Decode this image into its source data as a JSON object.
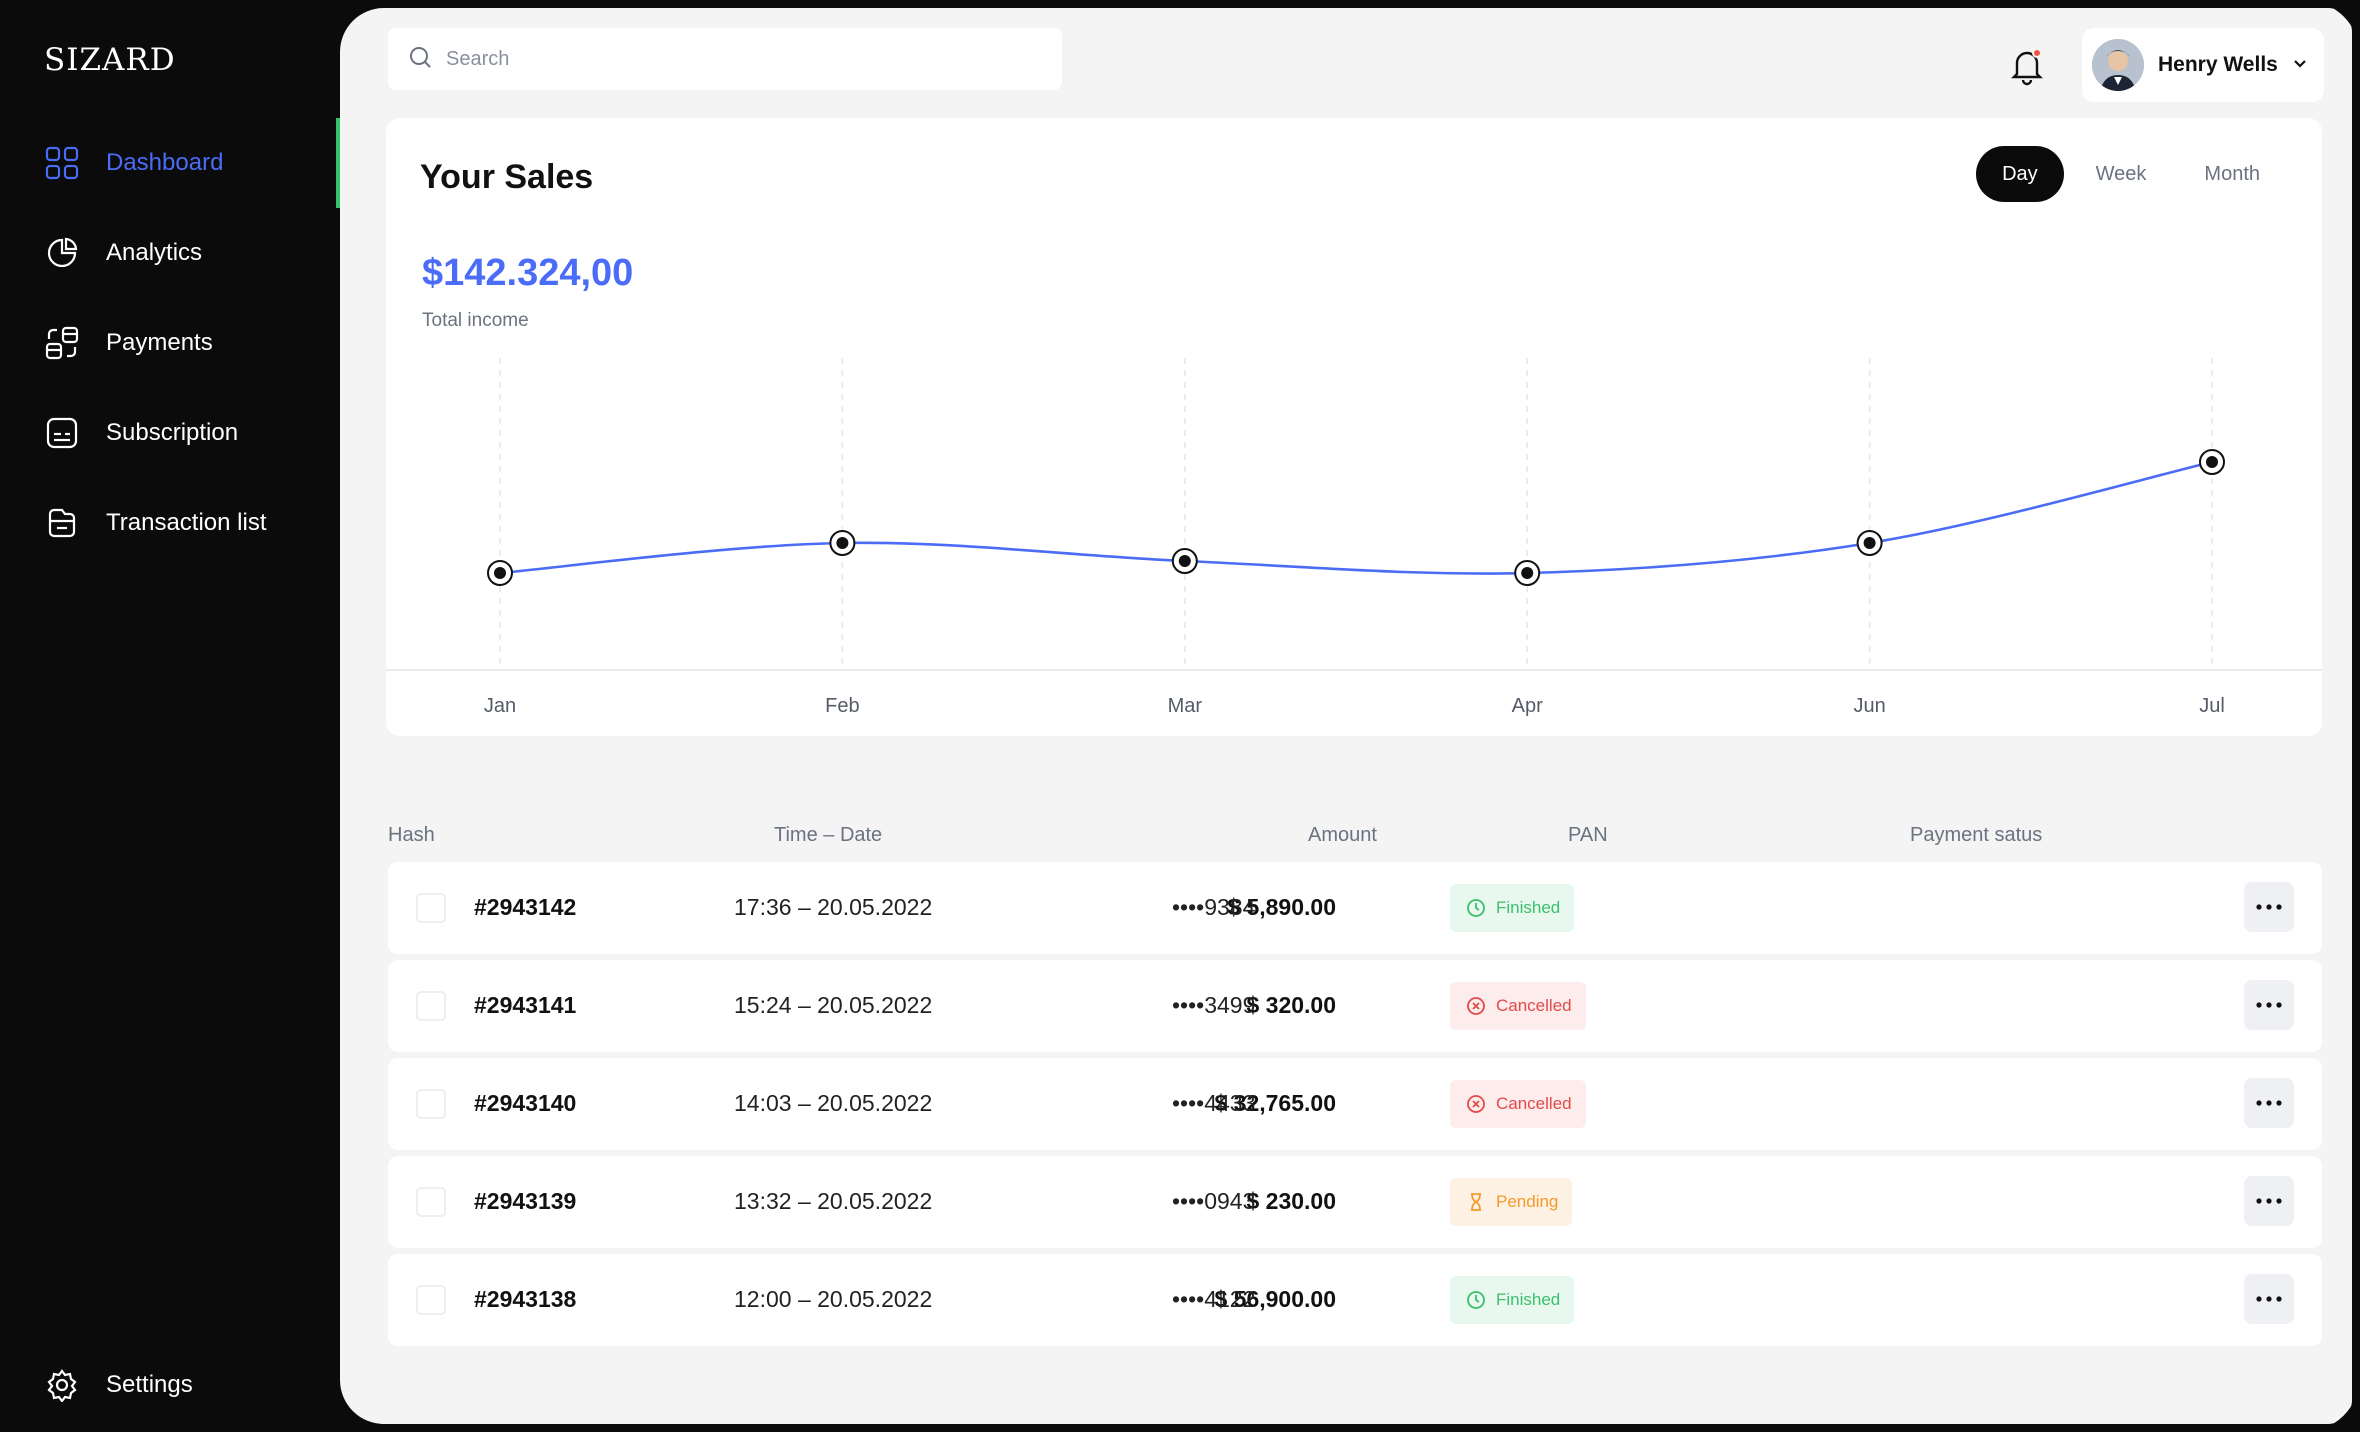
{
  "app": {
    "logo": "SIZARD"
  },
  "sidebar": {
    "items": [
      {
        "label": "Dashboard",
        "icon": "grid-icon",
        "active": true
      },
      {
        "label": "Analytics",
        "icon": "pie-chart-icon"
      },
      {
        "label": "Payments",
        "icon": "payments-icon"
      },
      {
        "label": "Subscription",
        "icon": "subscription-icon"
      },
      {
        "label": "Transaction list",
        "icon": "folder-icon"
      }
    ],
    "settings_label": "Settings"
  },
  "header": {
    "search_placeholder": "Search",
    "user_name": "Henry Wells",
    "has_notification": true
  },
  "sales": {
    "title": "Your Sales",
    "periods": [
      "Day",
      "Week",
      "Month"
    ],
    "active_period": "Day",
    "total": "$142.324,00",
    "total_label": "Total income",
    "accent": "#4A6CF7"
  },
  "chart_data": {
    "type": "line",
    "categories": [
      "Jan",
      "Feb",
      "Mar",
      "Apr",
      "Jun",
      "Jul"
    ],
    "values": [
      30,
      40,
      34,
      30,
      40,
      67
    ],
    "ylim": [
      0,
      100
    ],
    "smooth": true,
    "markers": true,
    "grid": "vertical-dashed",
    "color": "#4A6CF7"
  },
  "table": {
    "headers": {
      "hash": "Hash",
      "time": "Time – Date",
      "amount": "Amount",
      "pan": "PAN",
      "status": "Payment satus"
    },
    "rows": [
      {
        "hash": "#2943142",
        "time": "17:36 – 20.05.2022",
        "amount": "$ 5,890.00",
        "pan": "••••9384",
        "status": "Finished",
        "kind": "finished"
      },
      {
        "hash": "#2943141",
        "time": "15:24 – 20.05.2022",
        "amount": "$ 320.00",
        "pan": "••••3499",
        "status": "Cancelled",
        "kind": "cancelled"
      },
      {
        "hash": "#2943140",
        "time": "14:03 – 20.05.2022",
        "amount": "$ 32,765.00",
        "pan": "••••4433",
        "status": "Cancelled",
        "kind": "cancelled"
      },
      {
        "hash": "#2943139",
        "time": "13:32 – 20.05.2022",
        "amount": "$ 230.00",
        "pan": "••••0943",
        "status": "Pending",
        "kind": "pending"
      },
      {
        "hash": "#2943138",
        "time": "12:00 – 20.05.2022",
        "amount": "$ 56,900.00",
        "pan": "••••4122",
        "status": "Finished",
        "kind": "finished"
      }
    ]
  }
}
